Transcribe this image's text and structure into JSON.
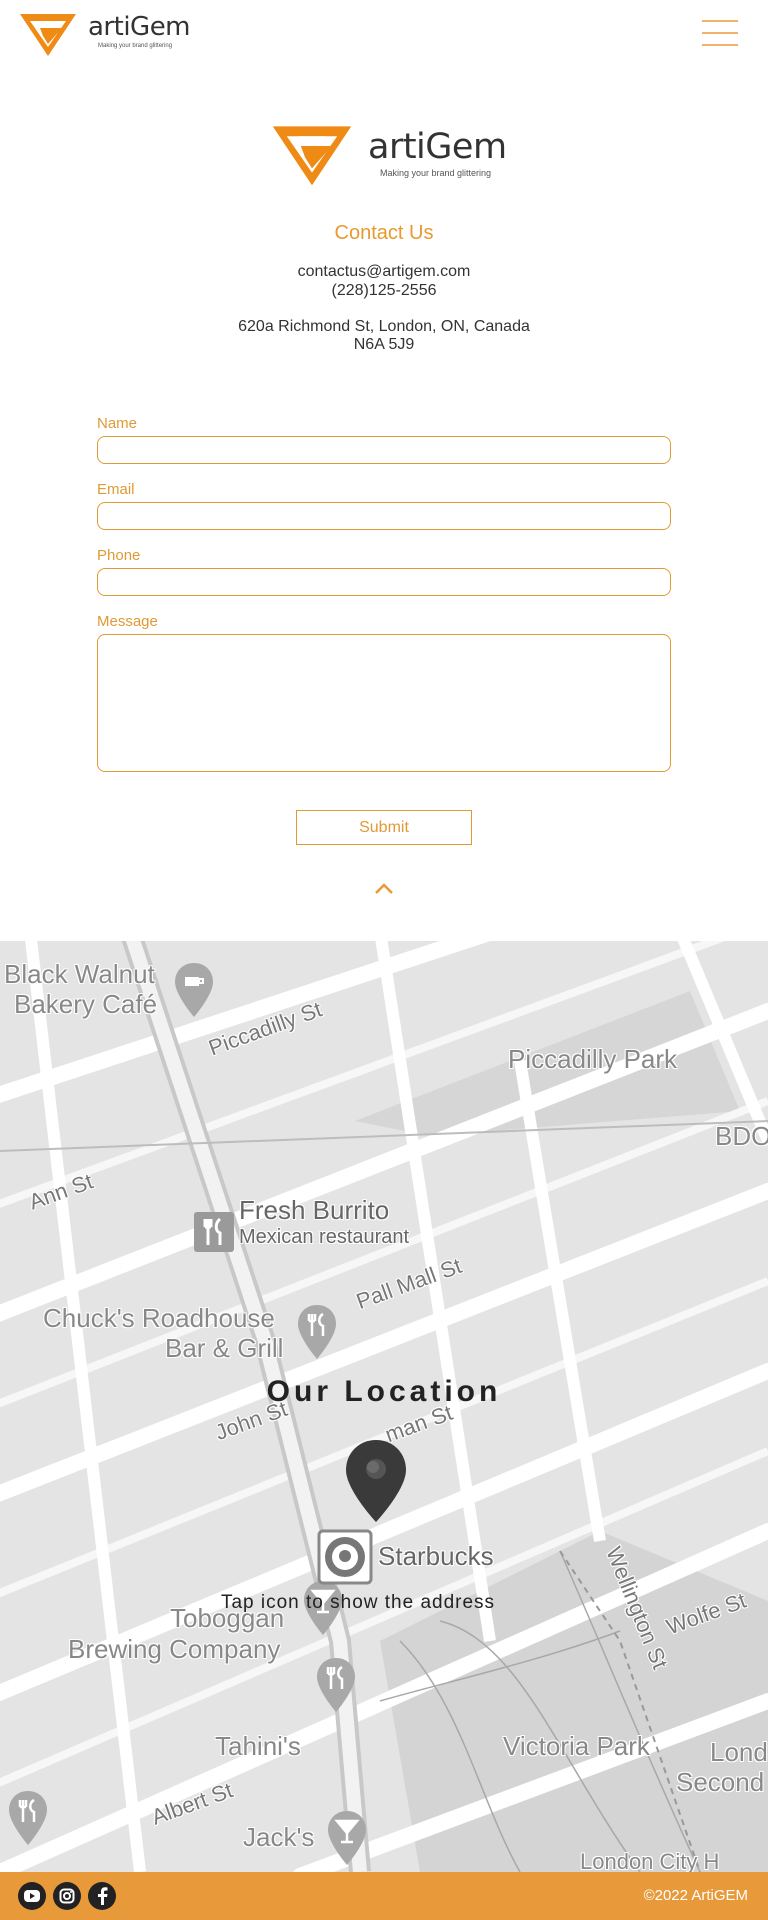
{
  "header": {
    "brand": "artiGem",
    "tagline": "Making your brand glittering"
  },
  "hero": {
    "brand": "artiGem",
    "tagline": "Making your brand glittering"
  },
  "contact": {
    "title": "Contact Us",
    "email": "contactus@artigem.com",
    "phone": "(228)125-2556",
    "address_line1": "620a Richmond St, London, ON, Canada",
    "address_line2": "N6A 5J9"
  },
  "form": {
    "name_label": "Name",
    "email_label": "Email",
    "phone_label": "Phone",
    "message_label": "Message",
    "name_value": "",
    "email_value": "",
    "phone_value": "",
    "message_value": "",
    "submit_label": "Submit"
  },
  "map": {
    "title": "Our Location",
    "hint": "Tap icon to show the address",
    "places": {
      "black_walnut_1": "Black Walnut",
      "black_walnut_2": "Bakery Café",
      "piccadilly_park": "Piccadilly Park",
      "bdo": "BDO",
      "fresh_burrito": "Fresh Burrito",
      "fresh_burrito_sub": "Mexican restaurant",
      "chucks_1": "Chuck's Roadhouse",
      "chucks_2": "Bar & Grill",
      "starbucks": "Starbucks",
      "toboggan_1": "Toboggan",
      "toboggan_2": "Brewing Company",
      "tahinis": "Tahini's",
      "jacks": "Jack's",
      "victoria_park": "Victoria Park",
      "lond_1": "Lond",
      "lond_2": "Second",
      "london_city_hall": "London City H"
    },
    "streets": {
      "piccadilly": "Piccadilly St",
      "ann": "Ann St",
      "pall_mall": "Pall Mall St",
      "john": "John St",
      "kent": "man St",
      "wellington": "Wellington St",
      "wolfe": "Wolfe St",
      "albert": "Albert St"
    },
    "colors": {
      "land": "#e4e4e4",
      "road": "#ffffff",
      "park": "#d3d3d3",
      "pin": "#3a3a3a"
    }
  },
  "footer": {
    "copyright": "©2022 ArtiGEM",
    "social": [
      "youtube-icon",
      "instagram-icon",
      "facebook-icon"
    ]
  },
  "theme": {
    "accent": "#e89a3a",
    "label": "#e09a35"
  }
}
